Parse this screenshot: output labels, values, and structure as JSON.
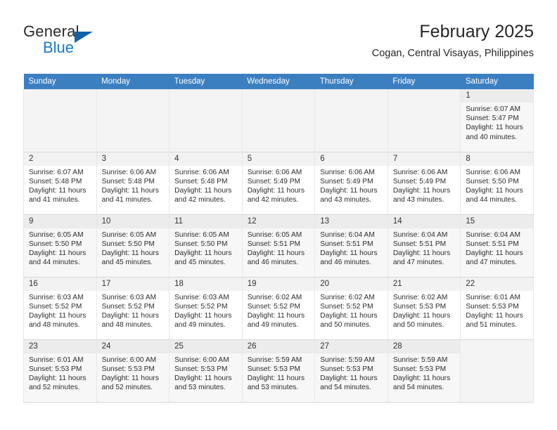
{
  "brand": {
    "name_part1": "General",
    "name_part2": "Blue",
    "triangle_color": "#1161a8",
    "blue_color": "#1b79c4"
  },
  "header": {
    "title": "February 2025",
    "subtitle": "Cogan, Central Visayas, Philippines"
  },
  "calendar": {
    "header_bg": "#3c7fc1",
    "header_text_color": "#ffffff",
    "weekday_headers": [
      "Sunday",
      "Monday",
      "Tuesday",
      "Wednesday",
      "Thursday",
      "Friday",
      "Saturday"
    ],
    "labels": {
      "sunrise": "Sunrise:",
      "sunset": "Sunset:",
      "daylight": "Daylight:"
    },
    "weeks": [
      [
        {
          "day": "",
          "empty": true
        },
        {
          "day": "",
          "empty": true
        },
        {
          "day": "",
          "empty": true
        },
        {
          "day": "",
          "empty": true
        },
        {
          "day": "",
          "empty": true
        },
        {
          "day": "",
          "empty": true
        },
        {
          "day": "1",
          "sunrise": "Sunrise: 6:07 AM",
          "sunset": "Sunset: 5:47 PM",
          "daylight_line1": "Daylight: 11 hours",
          "daylight_line2": "and 40 minutes."
        }
      ],
      [
        {
          "day": "2",
          "sunrise": "Sunrise: 6:07 AM",
          "sunset": "Sunset: 5:48 PM",
          "daylight_line1": "Daylight: 11 hours",
          "daylight_line2": "and 41 minutes."
        },
        {
          "day": "3",
          "sunrise": "Sunrise: 6:06 AM",
          "sunset": "Sunset: 5:48 PM",
          "daylight_line1": "Daylight: 11 hours",
          "daylight_line2": "and 41 minutes."
        },
        {
          "day": "4",
          "sunrise": "Sunrise: 6:06 AM",
          "sunset": "Sunset: 5:48 PM",
          "daylight_line1": "Daylight: 11 hours",
          "daylight_line2": "and 42 minutes."
        },
        {
          "day": "5",
          "sunrise": "Sunrise: 6:06 AM",
          "sunset": "Sunset: 5:49 PM",
          "daylight_line1": "Daylight: 11 hours",
          "daylight_line2": "and 42 minutes."
        },
        {
          "day": "6",
          "sunrise": "Sunrise: 6:06 AM",
          "sunset": "Sunset: 5:49 PM",
          "daylight_line1": "Daylight: 11 hours",
          "daylight_line2": "and 43 minutes."
        },
        {
          "day": "7",
          "sunrise": "Sunrise: 6:06 AM",
          "sunset": "Sunset: 5:49 PM",
          "daylight_line1": "Daylight: 11 hours",
          "daylight_line2": "and 43 minutes."
        },
        {
          "day": "8",
          "sunrise": "Sunrise: 6:06 AM",
          "sunset": "Sunset: 5:50 PM",
          "daylight_line1": "Daylight: 11 hours",
          "daylight_line2": "and 44 minutes."
        }
      ],
      [
        {
          "day": "9",
          "sunrise": "Sunrise: 6:05 AM",
          "sunset": "Sunset: 5:50 PM",
          "daylight_line1": "Daylight: 11 hours",
          "daylight_line2": "and 44 minutes."
        },
        {
          "day": "10",
          "sunrise": "Sunrise: 6:05 AM",
          "sunset": "Sunset: 5:50 PM",
          "daylight_line1": "Daylight: 11 hours",
          "daylight_line2": "and 45 minutes."
        },
        {
          "day": "11",
          "sunrise": "Sunrise: 6:05 AM",
          "sunset": "Sunset: 5:50 PM",
          "daylight_line1": "Daylight: 11 hours",
          "daylight_line2": "and 45 minutes."
        },
        {
          "day": "12",
          "sunrise": "Sunrise: 6:05 AM",
          "sunset": "Sunset: 5:51 PM",
          "daylight_line1": "Daylight: 11 hours",
          "daylight_line2": "and 46 minutes."
        },
        {
          "day": "13",
          "sunrise": "Sunrise: 6:04 AM",
          "sunset": "Sunset: 5:51 PM",
          "daylight_line1": "Daylight: 11 hours",
          "daylight_line2": "and 46 minutes."
        },
        {
          "day": "14",
          "sunrise": "Sunrise: 6:04 AM",
          "sunset": "Sunset: 5:51 PM",
          "daylight_line1": "Daylight: 11 hours",
          "daylight_line2": "and 47 minutes."
        },
        {
          "day": "15",
          "sunrise": "Sunrise: 6:04 AM",
          "sunset": "Sunset: 5:51 PM",
          "daylight_line1": "Daylight: 11 hours",
          "daylight_line2": "and 47 minutes."
        }
      ],
      [
        {
          "day": "16",
          "sunrise": "Sunrise: 6:03 AM",
          "sunset": "Sunset: 5:52 PM",
          "daylight_line1": "Daylight: 11 hours",
          "daylight_line2": "and 48 minutes."
        },
        {
          "day": "17",
          "sunrise": "Sunrise: 6:03 AM",
          "sunset": "Sunset: 5:52 PM",
          "daylight_line1": "Daylight: 11 hours",
          "daylight_line2": "and 48 minutes."
        },
        {
          "day": "18",
          "sunrise": "Sunrise: 6:03 AM",
          "sunset": "Sunset: 5:52 PM",
          "daylight_line1": "Daylight: 11 hours",
          "daylight_line2": "and 49 minutes."
        },
        {
          "day": "19",
          "sunrise": "Sunrise: 6:02 AM",
          "sunset": "Sunset: 5:52 PM",
          "daylight_line1": "Daylight: 11 hours",
          "daylight_line2": "and 49 minutes."
        },
        {
          "day": "20",
          "sunrise": "Sunrise: 6:02 AM",
          "sunset": "Sunset: 5:52 PM",
          "daylight_line1": "Daylight: 11 hours",
          "daylight_line2": "and 50 minutes."
        },
        {
          "day": "21",
          "sunrise": "Sunrise: 6:02 AM",
          "sunset": "Sunset: 5:53 PM",
          "daylight_line1": "Daylight: 11 hours",
          "daylight_line2": "and 50 minutes."
        },
        {
          "day": "22",
          "sunrise": "Sunrise: 6:01 AM",
          "sunset": "Sunset: 5:53 PM",
          "daylight_line1": "Daylight: 11 hours",
          "daylight_line2": "and 51 minutes."
        }
      ],
      [
        {
          "day": "23",
          "sunrise": "Sunrise: 6:01 AM",
          "sunset": "Sunset: 5:53 PM",
          "daylight_line1": "Daylight: 11 hours",
          "daylight_line2": "and 52 minutes."
        },
        {
          "day": "24",
          "sunrise": "Sunrise: 6:00 AM",
          "sunset": "Sunset: 5:53 PM",
          "daylight_line1": "Daylight: 11 hours",
          "daylight_line2": "and 52 minutes."
        },
        {
          "day": "25",
          "sunrise": "Sunrise: 6:00 AM",
          "sunset": "Sunset: 5:53 PM",
          "daylight_line1": "Daylight: 11 hours",
          "daylight_line2": "and 53 minutes."
        },
        {
          "day": "26",
          "sunrise": "Sunrise: 5:59 AM",
          "sunset": "Sunset: 5:53 PM",
          "daylight_line1": "Daylight: 11 hours",
          "daylight_line2": "and 53 minutes."
        },
        {
          "day": "27",
          "sunrise": "Sunrise: 5:59 AM",
          "sunset": "Sunset: 5:53 PM",
          "daylight_line1": "Daylight: 11 hours",
          "daylight_line2": "and 54 minutes."
        },
        {
          "day": "28",
          "sunrise": "Sunrise: 5:59 AM",
          "sunset": "Sunset: 5:53 PM",
          "daylight_line1": "Daylight: 11 hours",
          "daylight_line2": "and 54 minutes."
        },
        {
          "day": "",
          "empty": true
        }
      ]
    ]
  }
}
